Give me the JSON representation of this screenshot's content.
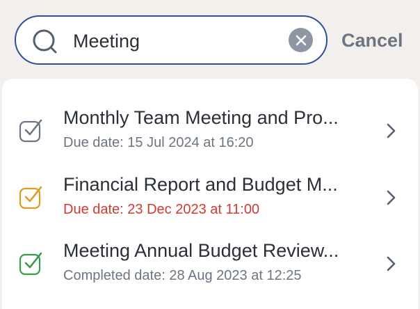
{
  "search": {
    "value": "Meeting",
    "icon": "search-icon",
    "clear_icon": "clear-icon",
    "cancel_label": "Cancel"
  },
  "results": [
    {
      "title": "Monthly Team Meeting and Pro...",
      "date": "Due date: 15 Jul 2024 at 16:20",
      "status_color": "#6c7582",
      "date_color": "#6c7582"
    },
    {
      "title": "Financial Report and Budget M...",
      "date": "Due date: 23 Dec 2023 at 11:00",
      "status_color": "#e09a1d",
      "date_color": "#d23a2f"
    },
    {
      "title": "Meeting Annual Budget Review...",
      "date": "Completed date: 28 Aug 2023 at 12:25",
      "status_color": "#3a9b4e",
      "date_color": "#6c7582"
    }
  ]
}
